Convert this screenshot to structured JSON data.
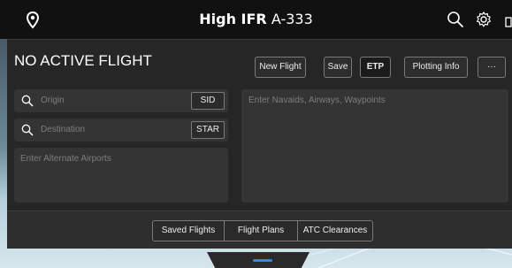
{
  "header": {
    "title_bold": "High IFR",
    "title_suffix": "A-333"
  },
  "panel": {
    "flight_status": "NO ACTIVE FLIGHT",
    "buttons": {
      "new_flight": "New Flight",
      "save": "Save",
      "etp": "ETP",
      "plotting_info": "Plotting Info",
      "more": "···"
    },
    "origin": {
      "placeholder": "Origin",
      "button": "SID"
    },
    "destination": {
      "placeholder": "Destination",
      "button": "STAR"
    },
    "alternates": {
      "placeholder": "Enter Alternate Airports"
    },
    "route": {
      "placeholder": "Enter Navaids, Airways, Waypoints"
    },
    "bottom_tabs": [
      "Saved Flights",
      "Flight Plans",
      "ATC Clearances"
    ]
  },
  "colors": {
    "accent": "#2b8be6",
    "panel_bg": "#262626",
    "field_bg": "#343434"
  },
  "icons": {
    "location": "map-pin-icon",
    "search": "search-icon",
    "settings": "gear-icon"
  }
}
